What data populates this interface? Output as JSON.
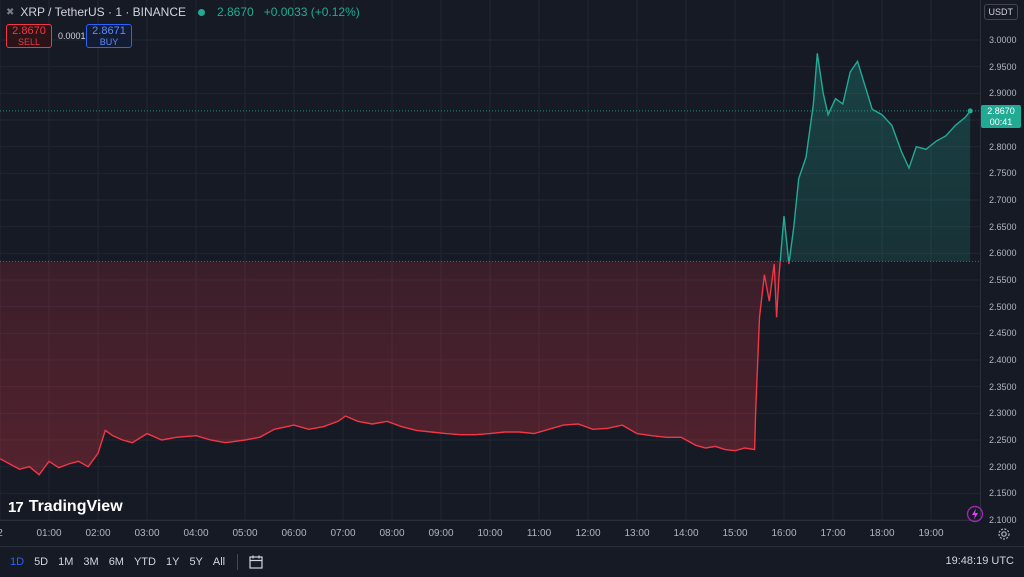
{
  "symbol": {
    "name": "XRP / TetherUS · 1 · BINANCE",
    "last_price": "2.8670",
    "change": "+0.0033 (+0.12%)"
  },
  "trade": {
    "sell_price": "2.8670",
    "sell_label": "SELL",
    "spread": "0.0001",
    "buy_price": "2.8671",
    "buy_label": "BUY"
  },
  "currency": "USDT",
  "last_price_tag": {
    "price": "2.8670",
    "countdown": "00:41"
  },
  "logo_text": "TradingView",
  "logo_mark": "17",
  "time_ranges": [
    "1D",
    "5D",
    "1M",
    "3M",
    "6M",
    "YTD",
    "1Y",
    "5Y",
    "All"
  ],
  "active_range": "1D",
  "clock": "19:48:19 UTC",
  "colors": {
    "up": "#22ab94",
    "down": "#f23645",
    "background": "#161a25",
    "grid": "#232632",
    "accent": "#2962ff"
  },
  "icons": [
    "collapse-icon",
    "status-dot",
    "calendar-icon",
    "settings-icon",
    "lightning-icon"
  ],
  "chart_data": {
    "type": "line",
    "title": "XRP / TetherUS · 1 · BINANCE",
    "xlabel": "",
    "ylabel": "",
    "x_ticks": [
      "2",
      "01:00",
      "02:00",
      "03:00",
      "04:00",
      "05:00",
      "06:00",
      "07:00",
      "08:00",
      "09:00",
      "10:00",
      "11:00",
      "12:00",
      "13:00",
      "14:00",
      "15:00",
      "16:00",
      "17:00",
      "18:00",
      "19:00"
    ],
    "y_ticks": [
      "3.0000",
      "2.9500",
      "2.9000",
      "2.8500",
      "2.8000",
      "2.7500",
      "2.7000",
      "2.6500",
      "2.6000",
      "2.5500",
      "2.5000",
      "2.4500",
      "2.4000",
      "2.3500",
      "2.3000",
      "2.2500",
      "2.2000",
      "2.1500",
      "2.1000"
    ],
    "ylim": [
      2.1,
      3.0
    ],
    "xlim": [
      0,
      19.8
    ],
    "baseline": 2.585,
    "last_price": 2.867,
    "series": [
      {
        "x": [
          0,
          0.2,
          0.4,
          0.6,
          0.8,
          1.0,
          1.2,
          1.4,
          1.6,
          1.8,
          2.0,
          2.15,
          2.3,
          2.5,
          2.7,
          3.0,
          3.3,
          3.6,
          4.0,
          4.3,
          4.6,
          5.0,
          5.3,
          5.6,
          6.0,
          6.3,
          6.6,
          6.9,
          7.05,
          7.3,
          7.6,
          7.9,
          8.2,
          8.5,
          8.8,
          9.1,
          9.4,
          9.7,
          10.0,
          10.3,
          10.6,
          10.9,
          11.2,
          11.5,
          11.8,
          12.1,
          12.4,
          12.7,
          13.0,
          13.3,
          13.6,
          13.9,
          14.2,
          14.4,
          14.6,
          14.8,
          15.0,
          15.2,
          15.4,
          15.42,
          15.5,
          15.6,
          15.7,
          15.8,
          15.85,
          15.9,
          16.0,
          16.1,
          16.2,
          16.3,
          16.45,
          16.6,
          16.68,
          16.8,
          16.9,
          17.05,
          17.2,
          17.35,
          17.5,
          17.6,
          17.8,
          18.0,
          18.2,
          18.4,
          18.55,
          18.7,
          18.9,
          19.1,
          19.3,
          19.5,
          19.7,
          19.8
        ],
        "y": [
          2.215,
          2.205,
          2.195,
          2.2,
          2.185,
          2.21,
          2.198,
          2.205,
          2.21,
          2.2,
          2.225,
          2.268,
          2.258,
          2.25,
          2.245,
          2.262,
          2.25,
          2.255,
          2.258,
          2.25,
          2.245,
          2.25,
          2.255,
          2.27,
          2.278,
          2.27,
          2.275,
          2.285,
          2.295,
          2.285,
          2.28,
          2.285,
          2.275,
          2.268,
          2.265,
          2.262,
          2.26,
          2.26,
          2.262,
          2.265,
          2.265,
          2.262,
          2.27,
          2.278,
          2.28,
          2.27,
          2.272,
          2.278,
          2.262,
          2.258,
          2.255,
          2.255,
          2.24,
          2.235,
          2.238,
          2.232,
          2.23,
          2.235,
          2.232,
          2.3,
          2.48,
          2.56,
          2.51,
          2.58,
          2.48,
          2.56,
          2.67,
          2.58,
          2.65,
          2.74,
          2.78,
          2.88,
          2.975,
          2.9,
          2.86,
          2.89,
          2.88,
          2.94,
          2.96,
          2.93,
          2.87,
          2.86,
          2.84,
          2.79,
          2.76,
          2.8,
          2.795,
          2.81,
          2.82,
          2.84,
          2.855,
          2.867
        ]
      }
    ]
  }
}
